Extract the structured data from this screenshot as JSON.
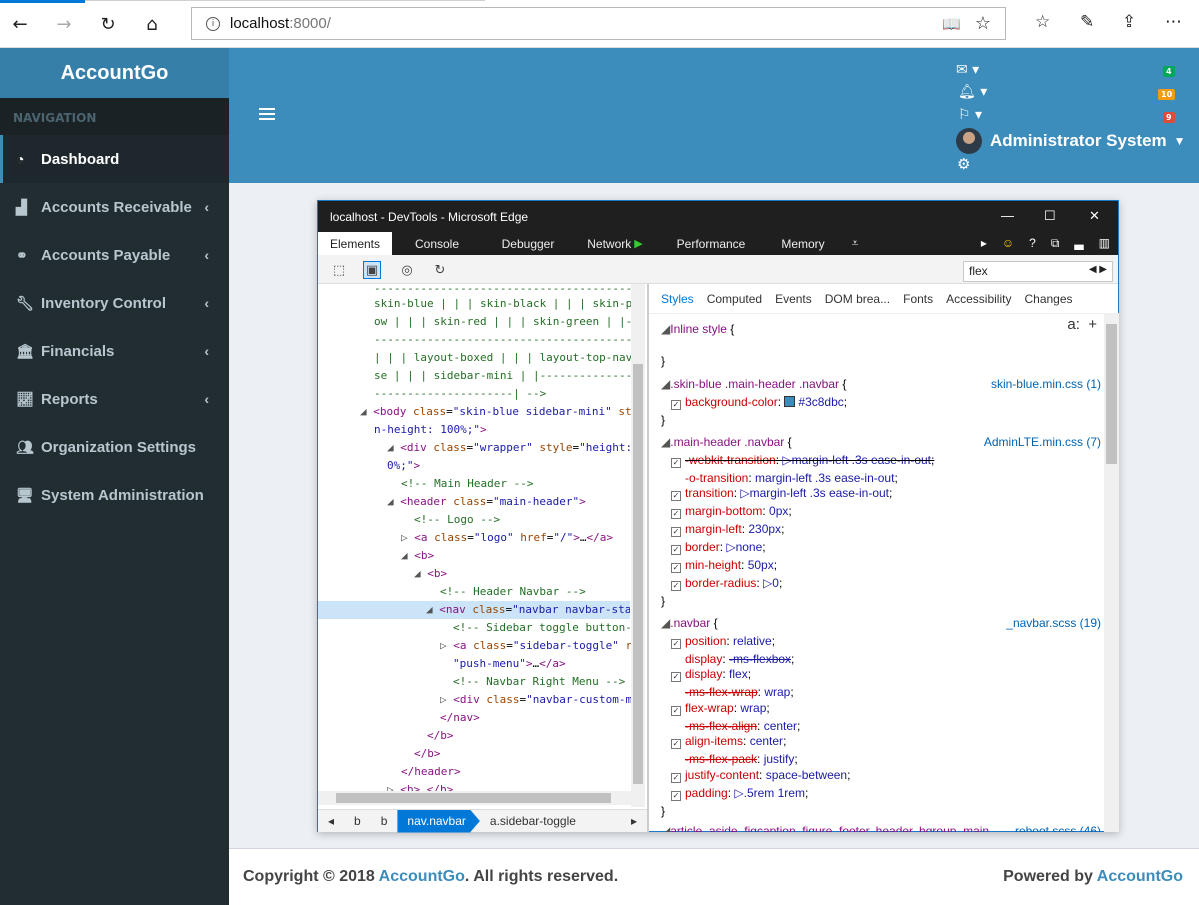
{
  "browser": {
    "url_host": "localhost",
    "url_rest": ":8000/"
  },
  "app": {
    "brand": "AccountGo",
    "navigation_header": "NAVIGATION",
    "sidebar_items": [
      {
        "label": "Dashboard",
        "icon": "dashboard-icon",
        "active": true
      },
      {
        "label": "Accounts Receivable",
        "icon": "chart-icon"
      },
      {
        "label": "Accounts Payable",
        "icon": "link-icon"
      },
      {
        "label": "Inventory Control",
        "icon": "wrench-icon"
      },
      {
        "label": "Financials",
        "icon": "bank-icon"
      },
      {
        "label": "Reports",
        "icon": "line-chart-icon"
      },
      {
        "label": "Organization Settings",
        "icon": "users-icon"
      },
      {
        "label": "System Administration",
        "icon": "desktop-icon"
      }
    ],
    "header": {
      "messages_badge": "4",
      "notifications_badge": "10",
      "tasks_badge": "9",
      "user_name": "Administrator System"
    },
    "footer": {
      "copyright_prefix": "Copyright © 2018 ",
      "copyright_link": "AccountGo",
      "copyright_suffix": ". All rights reserved.",
      "powered_prefix": "Powered by ",
      "powered_link": "AccountGo"
    }
  },
  "devtools": {
    "title": "localhost - DevTools - Microsoft Edge",
    "tabs": [
      "Elements",
      "Console",
      "Debugger",
      "Network",
      "Performance",
      "Memory"
    ],
    "search_value": "flex",
    "breadcrumbs": [
      "b",
      "b",
      "nav.navbar",
      "a.sidebar-toggle"
    ],
    "dom_lines": [
      "skin-blue | | | skin-black | | | skin-p",
      "ow | | | skin-red | | | skin-green | |-",
      "---------------------------------------| |L",
      "| | | layout-boxed | | | layout-top-nav",
      "se | | | sidebar-mini | |----------------",
      "---------------------| -->"
    ],
    "styles_tabs": [
      "Styles",
      "Computed",
      "Events",
      "DOM brea...",
      "Fonts",
      "Accessibility",
      "Changes"
    ],
    "rules": {
      "inline": "Inline style",
      "r1_selector": ".skin-blue .main-header .navbar",
      "r1_source": "skin-blue.min.css (1)",
      "r1_prop": "background-color",
      "r1_val": "#3c8dbc",
      "r2_selector": ".main-header .navbar",
      "r2_source": "AdminLTE.min.css (7)",
      "r3_selector": ".navbar",
      "r3_source": "_navbar.scss (19)",
      "r4_selector": "article, aside, figcaption, figure, footer, header, hgroup, main,",
      "r4_source": "reboot.scss (46)"
    }
  }
}
